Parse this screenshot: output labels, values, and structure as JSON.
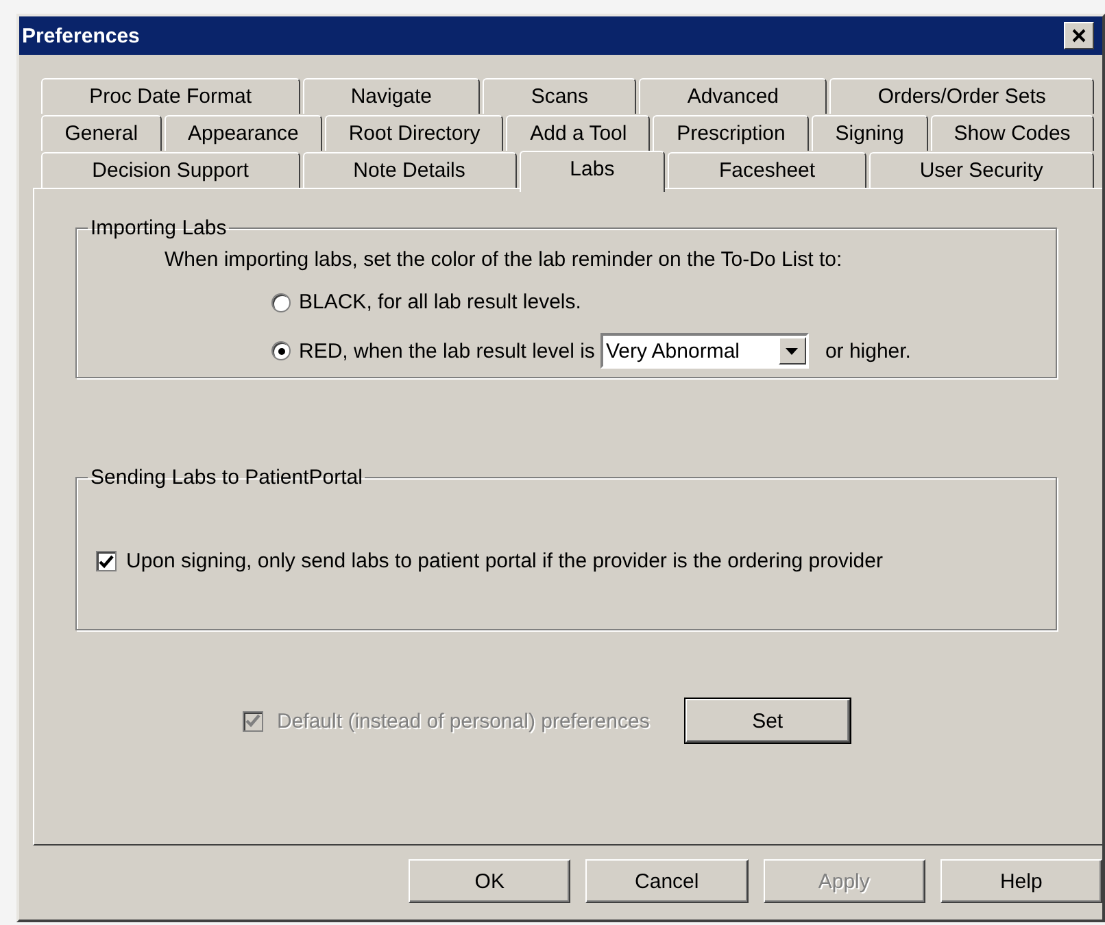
{
  "window": {
    "title": "Preferences"
  },
  "tab_rows": [
    [
      {
        "label": "Proc Date Format",
        "selected": false
      },
      {
        "label": "Navigate",
        "selected": false
      },
      {
        "label": "Scans",
        "selected": false
      },
      {
        "label": "Advanced",
        "selected": false
      },
      {
        "label": "Orders/Order Sets",
        "selected": false
      }
    ],
    [
      {
        "label": "General",
        "selected": false
      },
      {
        "label": "Appearance",
        "selected": false
      },
      {
        "label": "Root Directory",
        "selected": false
      },
      {
        "label": "Add a Tool",
        "selected": false
      },
      {
        "label": "Prescription",
        "selected": false
      },
      {
        "label": "Signing",
        "selected": false
      },
      {
        "label": "Show Codes",
        "selected": false
      }
    ],
    [
      {
        "label": "Decision Support",
        "selected": false
      },
      {
        "label": "Note Details",
        "selected": false
      },
      {
        "label": "Labs",
        "selected": true
      },
      {
        "label": "Facesheet",
        "selected": false
      },
      {
        "label": "User Security",
        "selected": false
      }
    ]
  ],
  "importing_labs": {
    "title": "Importing Labs",
    "intro": "When importing labs, set the color of the lab reminder on the To-Do List to:",
    "options": [
      {
        "label": "BLACK, for all lab result levels.",
        "selected": false
      },
      {
        "label": "RED, when the lab result level is",
        "selected": true,
        "dropdown_value": "Very Abnormal",
        "suffix": "or higher."
      }
    ]
  },
  "sending_labs": {
    "title": "Sending Labs to PatientPortal",
    "checkbox": {
      "label": "Upon signing, only send labs to patient portal if the provider is the ordering provider",
      "checked": true
    }
  },
  "default_prefs": {
    "label": "Default (instead of personal) preferences",
    "checked": true,
    "disabled": true
  },
  "set_button": {
    "label": "Set"
  },
  "buttons": [
    {
      "label": "OK",
      "disabled": false
    },
    {
      "label": "Cancel",
      "disabled": false
    },
    {
      "label": "Apply",
      "disabled": true
    },
    {
      "label": "Help",
      "disabled": false
    }
  ]
}
